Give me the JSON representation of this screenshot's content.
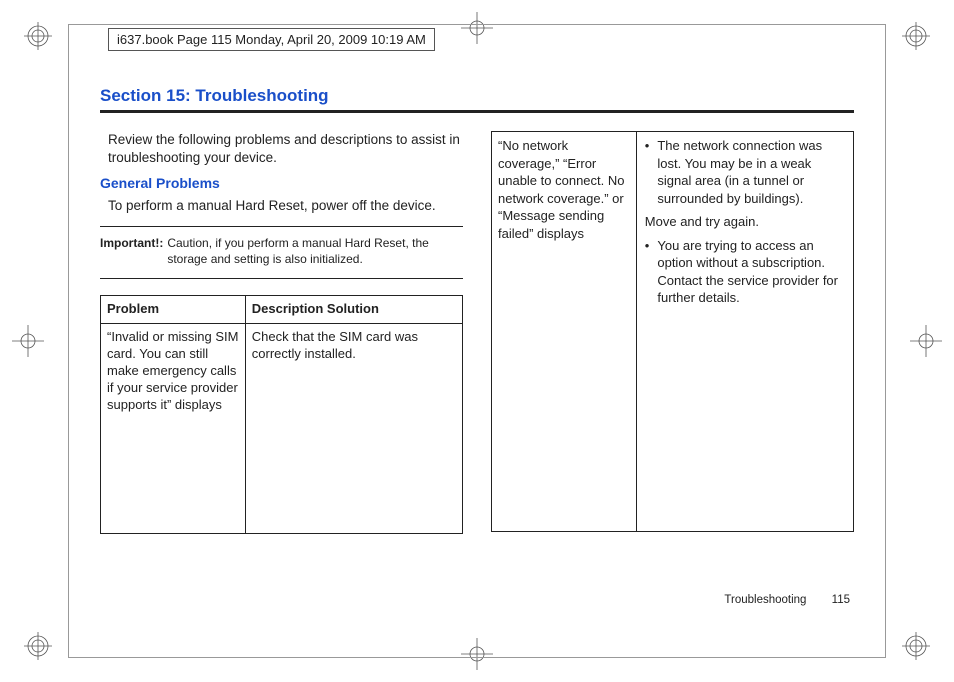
{
  "header": {
    "running_head": "i637.book  Page 115  Monday, April 20, 2009  10:19 AM"
  },
  "section": {
    "title": "Section 15: Troubleshooting",
    "intro": "Review the following problems and descriptions to assist in troubleshooting your device.",
    "sub_heading": "General Problems",
    "body_text": "To perform a manual Hard Reset, power off the device.",
    "important_label": "Important!:",
    "important_text": "Caution, if you perform a manual Hard Reset, the storage and setting is also initialized."
  },
  "table": {
    "headers": {
      "problem": "Problem",
      "solution": "Description Solution"
    },
    "rows": [
      {
        "problem": "“Invalid or missing SIM card. You can still make emergency calls if your service provider supports it” displays",
        "solution": "Check that the SIM card was correctly installed."
      }
    ]
  },
  "right_table": {
    "rows": [
      {
        "problem": "“No network coverage,” “Error unable to connect. No network coverage.” or “Message sending failed” displays",
        "bullets": [
          "The network connection was lost. You may be in a weak signal area (in a tunnel or surrounded by buildings).",
          "You are trying to access an option without a subscription. Contact the service provider for further details."
        ],
        "plain": "Move and try again."
      }
    ]
  },
  "footer": {
    "section_name": "Troubleshooting",
    "page_number": "115"
  }
}
